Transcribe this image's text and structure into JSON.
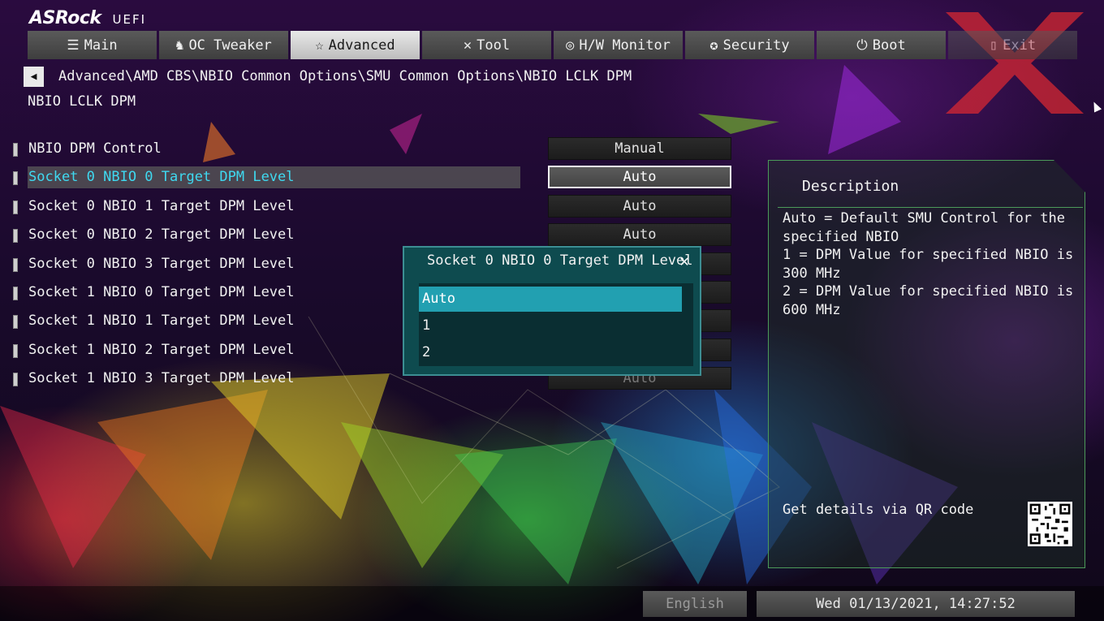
{
  "header": {
    "brand": "ASRock",
    "brand_sub": "UEFI",
    "tabs": [
      {
        "label": "Main",
        "icon": "list-icon"
      },
      {
        "label": "OC Tweaker",
        "icon": "rocket-icon"
      },
      {
        "label": "Advanced",
        "icon": "star-icon",
        "active": true
      },
      {
        "label": "Tool",
        "icon": "tools-icon"
      },
      {
        "label": "H/W Monitor",
        "icon": "monitor-gauge-icon"
      },
      {
        "label": "Security",
        "icon": "shield-icon"
      },
      {
        "label": "Boot",
        "icon": "power-icon"
      },
      {
        "label": "Exit",
        "icon": "exit-icon"
      }
    ]
  },
  "breadcrumb": "Advanced\\AMD CBS\\NBIO Common Options\\SMU Common Options\\NBIO LCLK DPM",
  "page_title": "NBIO LCLK DPM",
  "options": [
    {
      "label": "NBIO DPM Control",
      "value": "Manual"
    },
    {
      "label": "Socket 0 NBIO 0 Target DPM Level",
      "value": "Auto",
      "selected": true
    },
    {
      "label": "Socket 0 NBIO 1 Target DPM Level",
      "value": "Auto"
    },
    {
      "label": "Socket 0 NBIO 2 Target DPM Level",
      "value": "Auto"
    },
    {
      "label": "Socket 0 NBIO 3 Target DPM Level",
      "value": ""
    },
    {
      "label": "Socket 1 NBIO 0 Target DPM Level",
      "value": ""
    },
    {
      "label": "Socket 1 NBIO 1 Target DPM Level",
      "value": ""
    },
    {
      "label": "Socket 1 NBIO 2 Target DPM Level",
      "value": ""
    },
    {
      "label": "Socket 1 NBIO 3 Target DPM Level",
      "value": "Auto"
    }
  ],
  "popup": {
    "title": "Socket 0 NBIO 0 Target DPM Level",
    "options": [
      "Auto",
      "1",
      "2"
    ],
    "selected_index": 0
  },
  "description": {
    "title": "Description",
    "text": "Auto = Default SMU Control for the specified NBIO\n1 = DPM Value for specified NBIO is 300 MHz\n2 = DPM Value for specified NBIO is 600 MHz",
    "qr_label": "Get details via QR code"
  },
  "footer": {
    "language": "English",
    "datetime": "Wed 01/13/2021, 14:27:52"
  },
  "colors": {
    "highlight_text": "#3fd9f0",
    "popup_bg": "#0e4b4f",
    "popup_selected": "#22a0b1",
    "panel_border": "#4c9a5a"
  }
}
